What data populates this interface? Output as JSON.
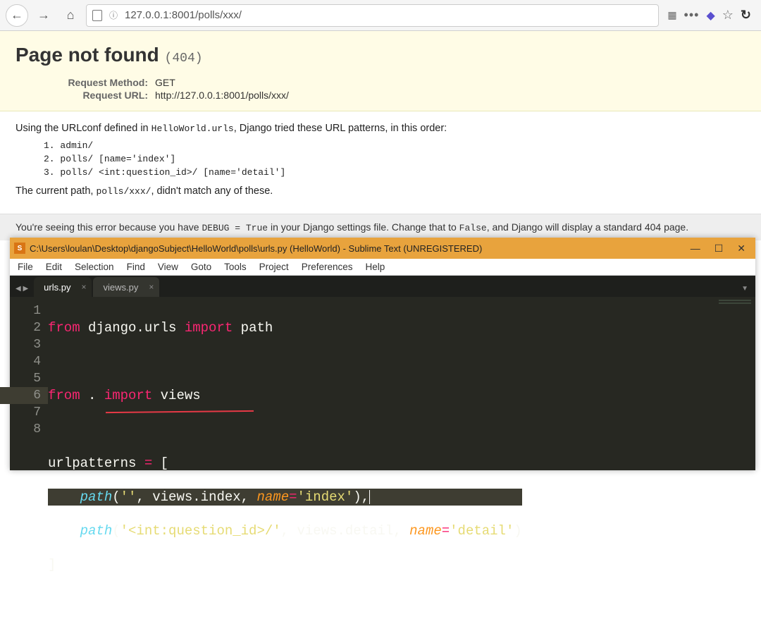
{
  "browser": {
    "url_display": "127.0.0.1:8001/polls/xxx/"
  },
  "django": {
    "title": "Page not found",
    "status_code": "(404)",
    "meta": {
      "method_label": "Request Method:",
      "method_value": "GET",
      "url_label": "Request URL:",
      "url_value": "http://127.0.0.1:8001/polls/xxx/"
    },
    "body_intro_pre": "Using the URLconf defined in ",
    "body_urlconf": "HelloWorld.urls",
    "body_intro_post": ", Django tried these URL patterns, in this order:",
    "patterns": [
      "1. admin/",
      "2. polls/ [name='index']",
      "3. polls/ <int:question_id>/ [name='detail']"
    ],
    "no_match_pre": "The current path, ",
    "no_match_path": "polls/xxx/",
    "no_match_post": ", didn't match any of these.",
    "footer_pre": "You're seeing this error because you have ",
    "footer_debug": "DEBUG = True",
    "footer_mid": " in your Django settings file. Change that to ",
    "footer_false": "False",
    "footer_post": ", and Django will display a standard 404 page."
  },
  "sublime": {
    "title_text": "C:\\Users\\loulan\\Desktop\\djangoSubject\\HelloWorld\\polls\\urls.py (HelloWorld) - Sublime Text (UNREGISTERED)",
    "menu": [
      "File",
      "Edit",
      "Selection",
      "Find",
      "View",
      "Goto",
      "Tools",
      "Project",
      "Preferences",
      "Help"
    ],
    "tabs": [
      {
        "label": "urls.py",
        "active": true
      },
      {
        "label": "views.py",
        "active": false
      }
    ],
    "line_numbers": [
      "1",
      "2",
      "3",
      "4",
      "5",
      "6",
      "7",
      "8"
    ],
    "code": {
      "l1_from": "from",
      "l1_mod": " django.urls ",
      "l1_import": "import",
      "l1_name": " path",
      "l3_from": "from",
      "l3_dot": " . ",
      "l3_import": "import",
      "l3_name": " views",
      "l5_var": "urlpatterns ",
      "l5_eq": "=",
      "l5_open": " [",
      "l6_indent": "    ",
      "l6_path": "path",
      "l6_open": "(",
      "l6_str1": "''",
      "l6_comma": ", ",
      "l6_views": "views.index",
      "l6_c2": ", ",
      "l6_param": "name",
      "l6_eq": "=",
      "l6_str2": "'index'",
      "l6_close": "),",
      "l7_indent": "    ",
      "l7_path": "path",
      "l7_open": "(",
      "l7_str1": "'<int:question_id>/'",
      "l7_comma": ", ",
      "l7_views": "views.detail",
      "l7_c2": ", ",
      "l7_param": "name",
      "l7_eq": "=",
      "l7_str2": "'detail'",
      "l7_close": ")",
      "l8_close": "]"
    }
  }
}
